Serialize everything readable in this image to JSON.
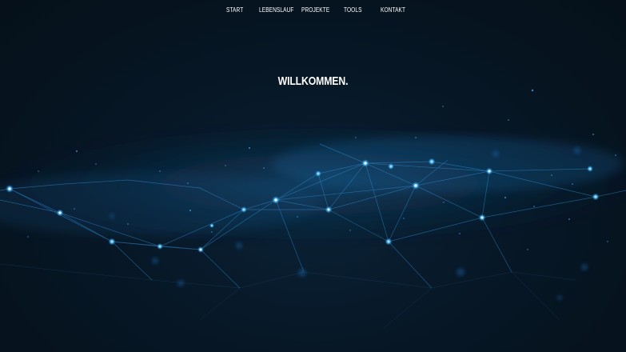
{
  "nav": {
    "items": [
      {
        "label": "START"
      },
      {
        "label": "LEBENSLAUF"
      },
      {
        "label": "PROJEKTE"
      },
      {
        "label": "TOOLS"
      },
      {
        "label": "KONTAKT"
      }
    ]
  },
  "hero": {
    "title": "WILLKOMMEN."
  },
  "colors": {
    "background": "#06121f",
    "network_line": "#2f8fd6",
    "network_node": "#7fd8ff",
    "text": "#ffffff"
  }
}
